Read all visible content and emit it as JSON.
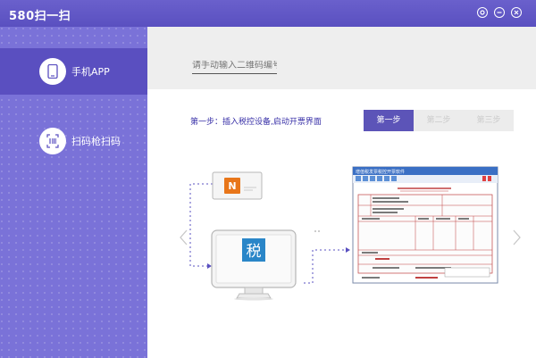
{
  "app": {
    "title": "580扫一扫"
  },
  "window_controls": [
    {
      "icon": "settings-icon"
    },
    {
      "icon": "minimize-icon"
    },
    {
      "icon": "close-icon"
    }
  ],
  "sidebar": {
    "items": [
      {
        "label": "手机APP",
        "icon": "phone-icon",
        "active": true
      },
      {
        "label": "扫码枪扫码",
        "icon": "barcode-scanner-icon",
        "active": false
      }
    ]
  },
  "main": {
    "code_input": {
      "value": "",
      "placeholder": "请手动输入二维码编号"
    },
    "step_description": "第一步：插入税控设备,启动开票界面",
    "steps": [
      {
        "label": "第一步",
        "active": true
      },
      {
        "label": "第二步",
        "active": false
      },
      {
        "label": "第三步",
        "active": false
      }
    ],
    "illustration": {
      "device_logo_text": "N",
      "monitor_glyph": "税",
      "invoice_window_title": "增值税发票税控开票软件"
    }
  },
  "colors": {
    "titlebar": "#5a50c0",
    "sidebar": "#7a72d8",
    "sidebar_active": "#5a4fc0",
    "accent_text": "#3a32a8",
    "step_active": "#5c54b8",
    "device_orange": "#e8761a"
  }
}
